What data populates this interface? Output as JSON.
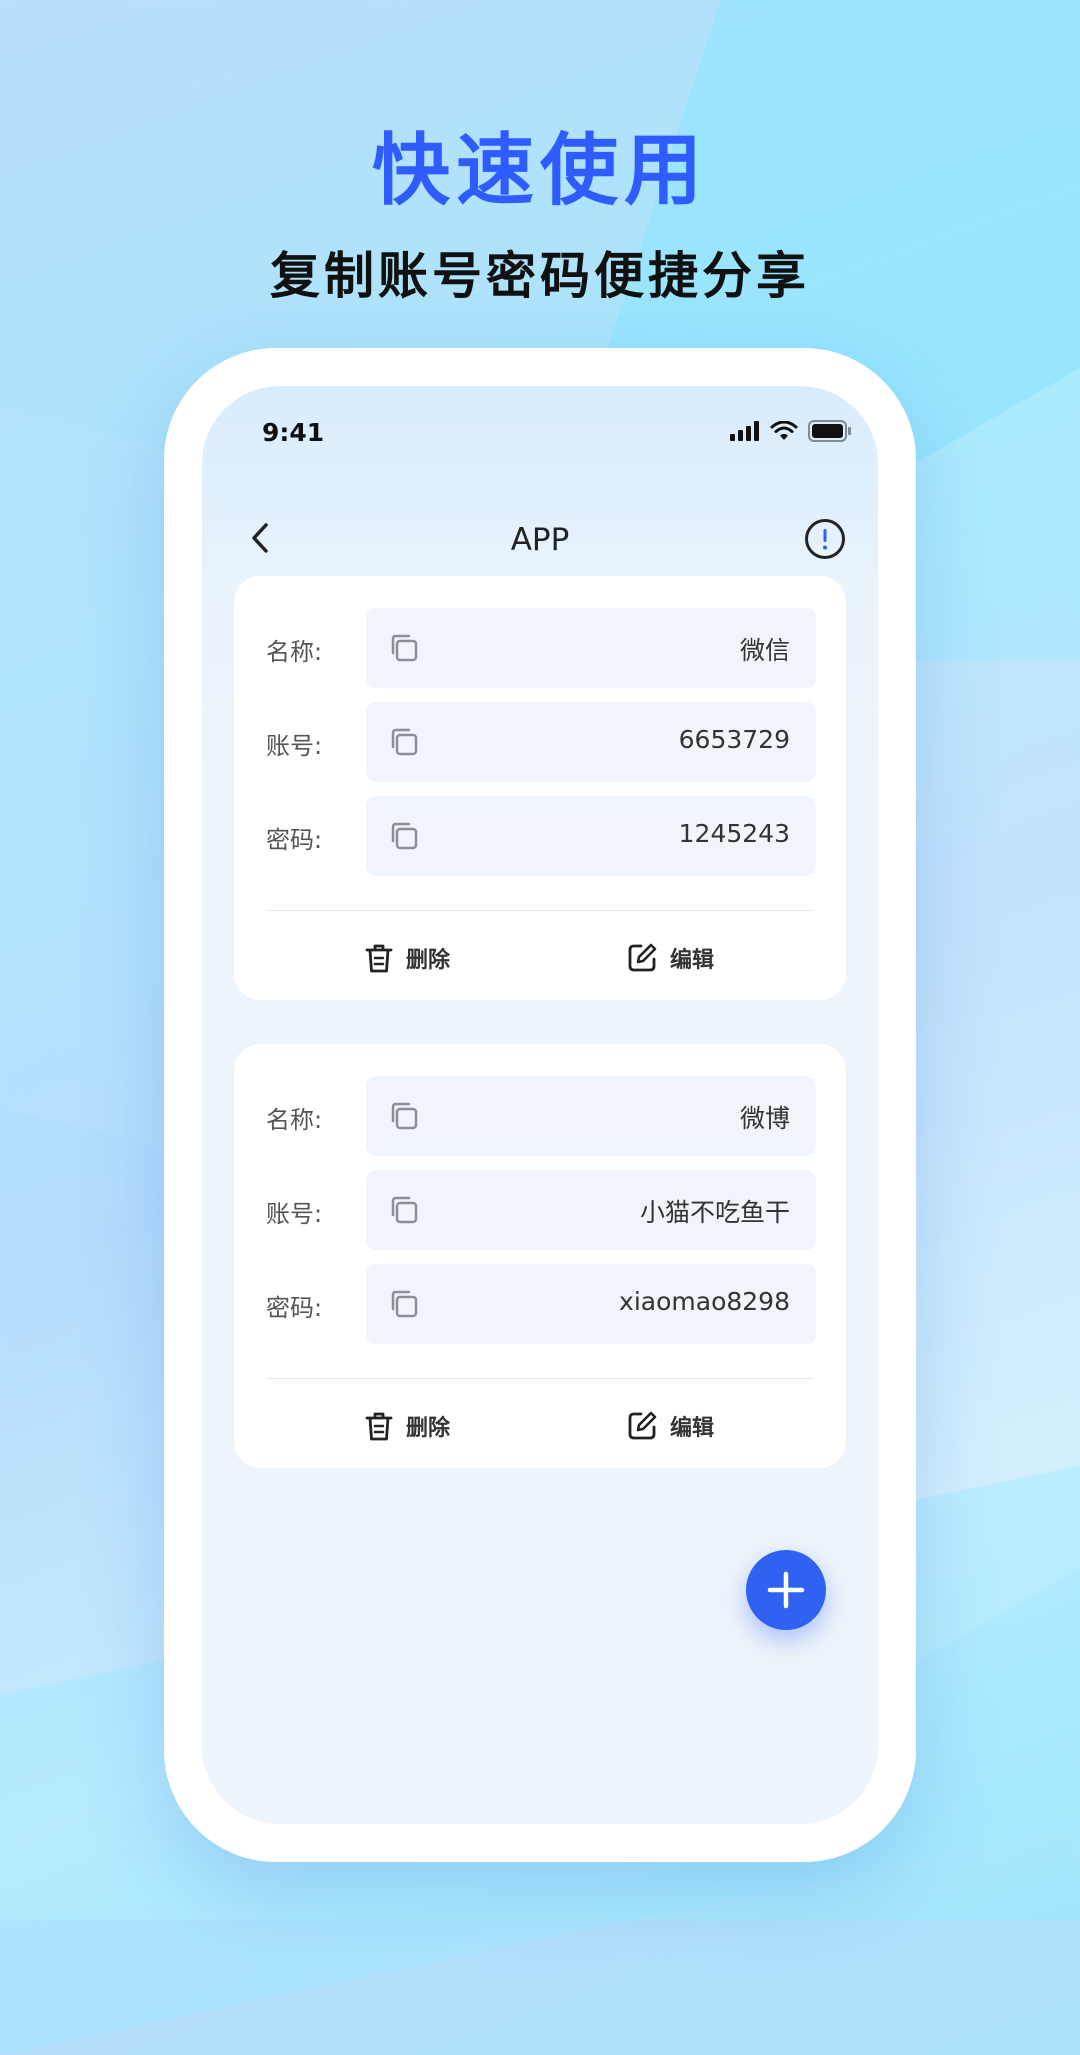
{
  "promo": {
    "title": "快速使用",
    "subtitle": "复制账号密码便捷分享"
  },
  "status_bar": {
    "time": "9:41",
    "icons": [
      "signal-icon",
      "wifi-icon",
      "battery-icon"
    ]
  },
  "nav": {
    "title": "APP",
    "back_icon": "chevron-left-icon",
    "info_icon": "info-circle-icon"
  },
  "cards": [
    {
      "fields": [
        {
          "label": "名称:",
          "value": "微信"
        },
        {
          "label": "账号:",
          "value": "6653729"
        },
        {
          "label": "密码:",
          "value": "1245243"
        }
      ],
      "delete_label": "删除",
      "edit_label": "编辑"
    },
    {
      "fields": [
        {
          "label": "名称:",
          "value": "微博"
        },
        {
          "label": "账号:",
          "value": "小猫不吃鱼干"
        },
        {
          "label": "密码:",
          "value": "xiaomao8298"
        }
      ],
      "delete_label": "删除",
      "edit_label": "编辑"
    }
  ],
  "fab": {
    "icon": "plus-icon"
  },
  "colors": {
    "accent": "#2f62f0",
    "title_blue": "#2f5cff",
    "field_bg": "#eff5fb"
  }
}
